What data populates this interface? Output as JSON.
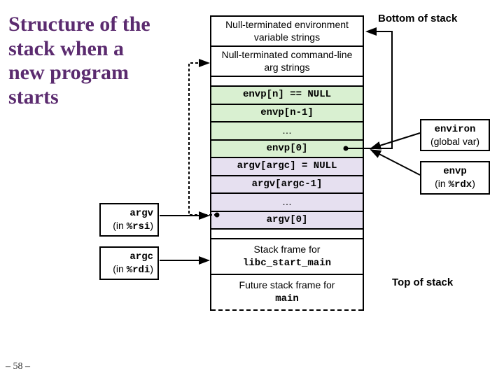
{
  "title": "Structure of the stack when a new program starts",
  "slide_number": "– 58 –",
  "labels": {
    "bottom": "Bottom of stack",
    "top": "Top of stack"
  },
  "stack": {
    "env_strings": "Null-terminated environment variable strings",
    "arg_strings": "Null-terminated command-line arg strings",
    "envp_null": "envp[n] == NULL",
    "envp_last": "envp[n-1]",
    "envp_dots": "…",
    "envp_0": "envp[0]",
    "argv_null": "argv[argc] = NULL",
    "argv_last": "argv[argc-1]",
    "argv_dots": "…",
    "argv_0": "argv[0]",
    "libc_frame_1": "Stack frame for",
    "libc_frame_2": "libc_start_main",
    "future_1": "Future stack frame for",
    "future_2": "main"
  },
  "side": {
    "environ_1": "environ",
    "environ_2": "(global var)",
    "envp_1": "envp",
    "envp_2_a": "(in ",
    "envp_2_b": "%rdx",
    "envp_2_c": ")",
    "argv_1": "argv",
    "argv_2_a": "(in ",
    "argv_2_b": "%rsi",
    "argv_2_c": ")",
    "argc_1": "argc",
    "argc_2_a": "(in ",
    "argc_2_b": "%rdi",
    "argc_2_c": ")"
  }
}
